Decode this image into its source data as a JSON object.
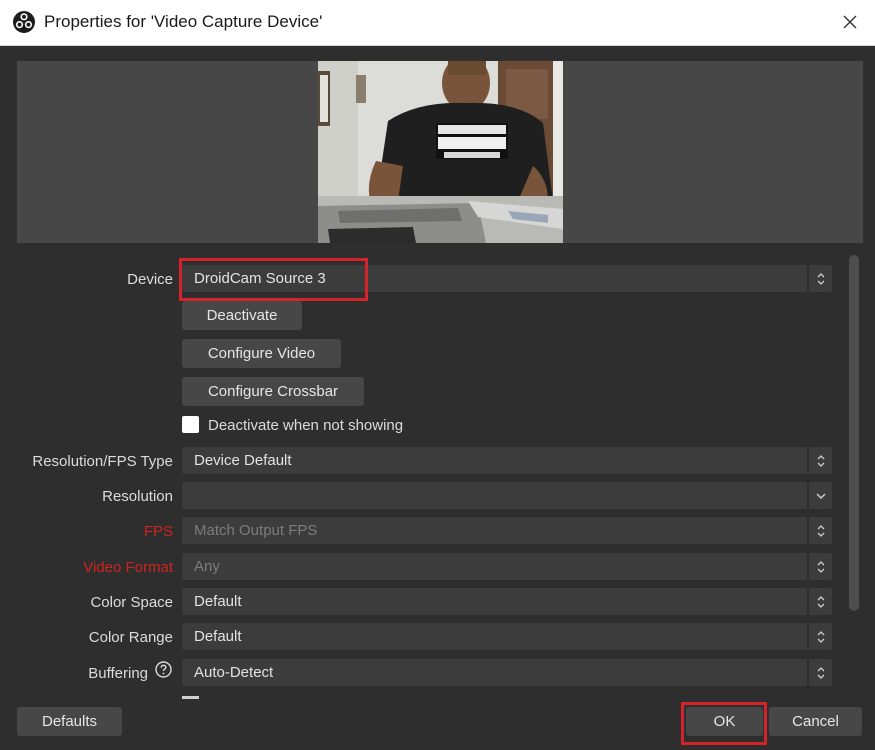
{
  "window": {
    "title": "Properties for 'Video Capture Device'",
    "icons": {
      "app": "obs-logo-icon",
      "close": "close-icon"
    }
  },
  "device": {
    "label": "Device",
    "value": "DroidCam Source 3",
    "buttons": [
      "Deactivate",
      "Configure Video",
      "Configure Crossbar"
    ],
    "deactivate_when_not_showing": {
      "label": "Deactivate when not showing",
      "checked": false
    }
  },
  "settings": [
    {
      "label": "Resolution/FPS Type",
      "value": "Device Default",
      "control": "spinner"
    },
    {
      "label": "Resolution",
      "value": "",
      "control": "dropdown"
    },
    {
      "label": "FPS",
      "value": "Match Output FPS",
      "control": "spinner",
      "disabled": true,
      "label_color": "#d2231f"
    },
    {
      "label": "Video Format",
      "value": "Any",
      "control": "spinner",
      "disabled": true,
      "label_color": "#d2231f"
    },
    {
      "label": "Color Space",
      "value": "Default",
      "control": "spinner"
    },
    {
      "label": "Color Range",
      "value": "Default",
      "control": "spinner"
    },
    {
      "label": "Buffering",
      "value": "Auto-Detect",
      "control": "spinner",
      "help_icon": "help-circle-icon"
    }
  ],
  "footer": {
    "defaults": "Defaults",
    "ok": "OK",
    "cancel": "Cancel"
  },
  "colors": {
    "background": "#2e2e2e",
    "control": "#3c3c3c",
    "button": "#474747",
    "highlight": "#d4232b",
    "warning_label": "#d2231f"
  }
}
